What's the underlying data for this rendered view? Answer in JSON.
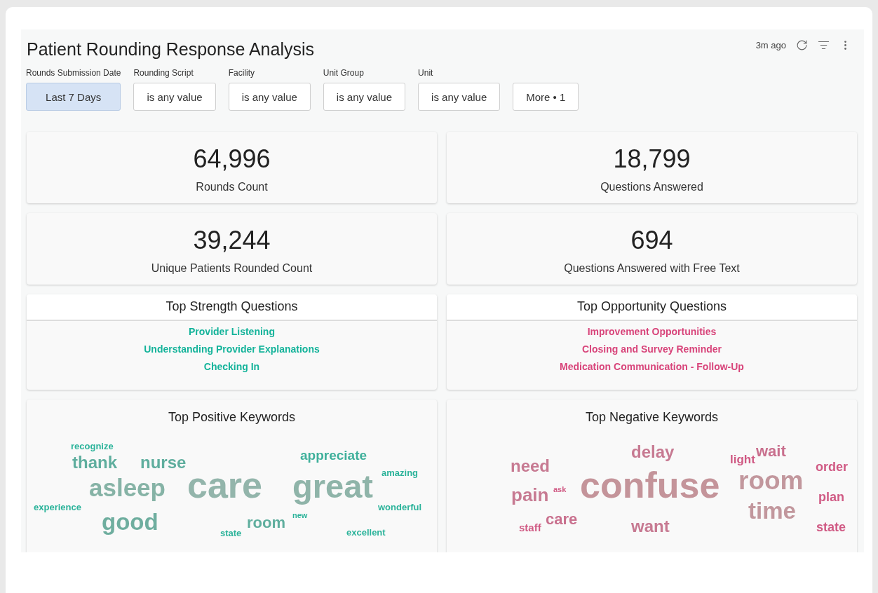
{
  "title": "Patient Rounding Response Analysis",
  "toolbar": {
    "updated": "3m ago"
  },
  "filters": [
    {
      "label": "Rounds Submission Date",
      "value": "Last 7 Days",
      "selected": true
    },
    {
      "label": "Rounding Script",
      "value": "is any value",
      "selected": false
    },
    {
      "label": "Facility",
      "value": "is any value",
      "selected": false
    },
    {
      "label": "Unit Group",
      "value": "is any value",
      "selected": false
    },
    {
      "label": "Unit",
      "value": "is any value",
      "selected": false
    }
  ],
  "more_button": "More • 1",
  "metrics": [
    {
      "value": "64,996",
      "label": "Rounds Count"
    },
    {
      "value": "18,799",
      "label": "Questions Answered"
    },
    {
      "value": "39,244",
      "label": "Unique Patients Rounded Count"
    },
    {
      "value": "694",
      "label": "Questions Answered with Free Text"
    }
  ],
  "question_lists": [
    {
      "title": "Top Strength Questions",
      "color": "#14b39a",
      "items": [
        "Provider Listening",
        "Understanding Provider Explanations",
        "Checking In"
      ]
    },
    {
      "title": "Top Opportunity Questions",
      "color": "#d8447a",
      "items": [
        "Improvement Opportunities",
        "Closing and Survey Reminder",
        "Medication Communication - Follow-Up"
      ]
    }
  ],
  "keyword_clouds": [
    {
      "title": "Top Positive Keywords",
      "words": [
        {
          "text": "recognize",
          "color": "#2bb39a"
        },
        {
          "text": "thank",
          "color": "#5fae9e"
        },
        {
          "text": "nurse",
          "color": "#5fae9e"
        },
        {
          "text": "appreciate",
          "color": "#3fb09b"
        },
        {
          "text": "amazing",
          "color": "#2bb39a"
        },
        {
          "text": "asleep",
          "color": "#86b3a6"
        },
        {
          "text": "care",
          "color": "#93b5ab"
        },
        {
          "text": "great",
          "color": "#8fb4a9"
        },
        {
          "text": "experience",
          "color": "#2bb39a"
        },
        {
          "text": "wonderful",
          "color": "#2bb39a"
        },
        {
          "text": "good",
          "color": "#6fae9f"
        },
        {
          "text": "new",
          "color": "#2bb39a"
        },
        {
          "text": "room",
          "color": "#5fae9e"
        },
        {
          "text": "state",
          "color": "#2bb39a"
        },
        {
          "text": "excellent",
          "color": "#2bb39a"
        }
      ]
    },
    {
      "title": "Top Negative Keywords",
      "words": [
        {
          "text": "delay",
          "color": "#c77a92"
        },
        {
          "text": "light",
          "color": "#d05a84"
        },
        {
          "text": "wait",
          "color": "#c9708e"
        },
        {
          "text": "need",
          "color": "#c77a92"
        },
        {
          "text": "order",
          "color": "#d05a84"
        },
        {
          "text": "confuse",
          "color": "#c4949a"
        },
        {
          "text": "room",
          "color": "#c2979d"
        },
        {
          "text": "pain",
          "color": "#c77a92"
        },
        {
          "text": "ask",
          "color": "#d05a84"
        },
        {
          "text": "plan",
          "color": "#d05a84"
        },
        {
          "text": "time",
          "color": "#c2979d"
        },
        {
          "text": "staff",
          "color": "#d05a84"
        },
        {
          "text": "care",
          "color": "#c9708e"
        },
        {
          "text": "want",
          "color": "#c77a92"
        },
        {
          "text": "state",
          "color": "#d05a84"
        }
      ]
    }
  ]
}
